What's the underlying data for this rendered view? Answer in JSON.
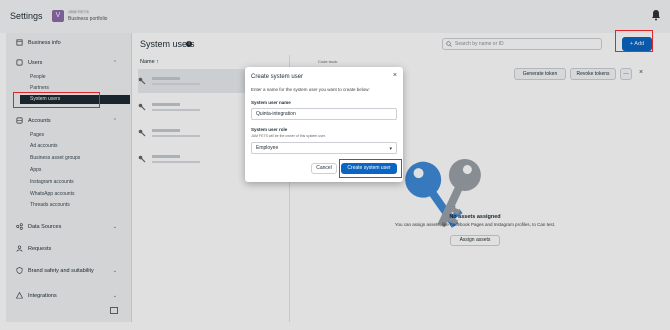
{
  "app": {
    "title": "Settings",
    "account_initial": "V",
    "account_name": "JAM FETS",
    "account_sub": "Business portfolio"
  },
  "sidebar": {
    "business_info": "Business info",
    "users": "Users",
    "users_items": [
      "People",
      "Partners",
      "System users"
    ],
    "accounts": "Accounts",
    "accounts_items": [
      "Pages",
      "Ad accounts",
      "Business asset groups",
      "Apps",
      "Instagram accounts",
      "WhatsApp accounts",
      "Threads accounts"
    ],
    "data_sources": "Data Sources",
    "requests": "Requests",
    "brand_safety": "Brand safety and suitability",
    "integrations": "Integrations"
  },
  "main": {
    "title": "System users",
    "search_placeholder": "Search by name or ID",
    "add_label": "+ Add",
    "list_header": "Name ↑",
    "detail_label": "Code truck",
    "generate_token": "Generate token",
    "revoke_tokens": "Revoke tokens",
    "more": "…",
    "close": "×",
    "empty_title": "No assets assigned",
    "empty_sub": "You can assign assets, like Facebook Pages and Instagram profiles, to Can test.",
    "assign_assets": "Assign assets"
  },
  "modal": {
    "title": "Create system user",
    "close": "×",
    "description": "Enter a name for the system user you want to create below:",
    "name_label": "System user name",
    "name_value": "Quinta-integration",
    "role_label": "System user role",
    "role_hint": "JAM FETS will be the owner of this system user.",
    "role_value": "Employee",
    "cancel": "Cancel",
    "create": "Create system user"
  },
  "colors": {
    "accent": "#0a66c2",
    "highlight": "#e0242c",
    "active_nav": "#1c2b33"
  }
}
